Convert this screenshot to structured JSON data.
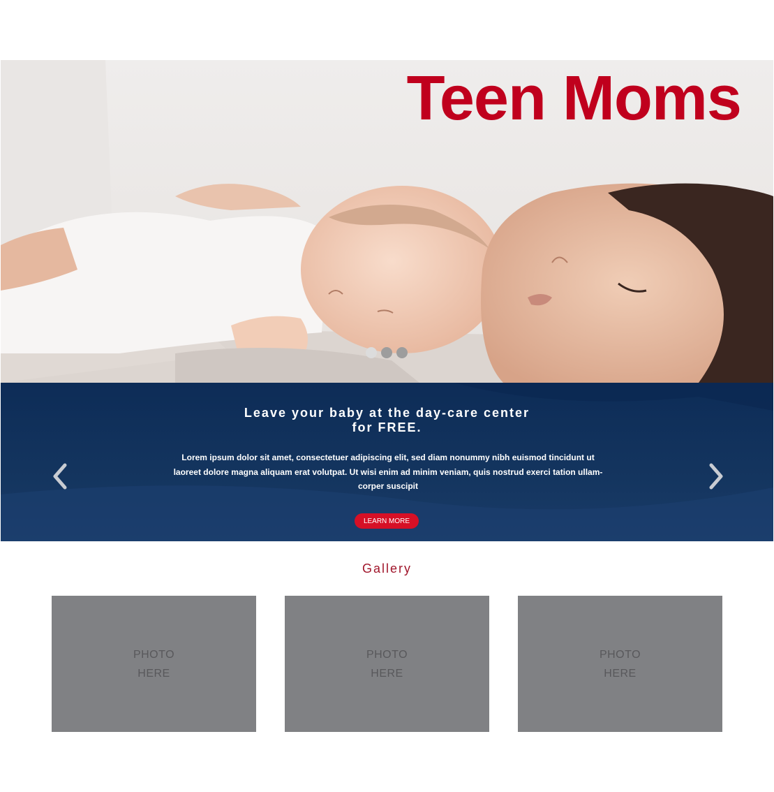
{
  "hero": {
    "title": "Teen Moms",
    "image": "mother-and-sleeping-baby-photo",
    "carousel_dots": 3,
    "active_dot": 1
  },
  "banner": {
    "heading_line1": "Leave your baby at the day-care center",
    "heading_line2": "for FREE.",
    "body": "Lorem ipsum dolor sit amet, consectetuer adipiscing elit, sed diam nonummy nibh euismod tincidunt ut laoreet dolore magna aliquam erat volutpat. Ut wisi enim ad minim veniam, quis nostrud exerci tation ullam-corper suscipit",
    "button_label": "LEARN MORE",
    "prev_icon": "chevron-left-icon",
    "next_icon": "chevron-right-icon"
  },
  "gallery": {
    "title": "Gallery",
    "items": [
      {
        "line1": "PHOTO",
        "line2": "HERE"
      },
      {
        "line1": "PHOTO",
        "line2": "HERE"
      },
      {
        "line1": "PHOTO",
        "line2": "HERE"
      }
    ]
  },
  "colors": {
    "title_red": "#c0001d",
    "banner_blue": "#14355f",
    "button_red": "#d61026",
    "gallery_title": "#a0152a",
    "placeholder_gray": "#808184"
  }
}
